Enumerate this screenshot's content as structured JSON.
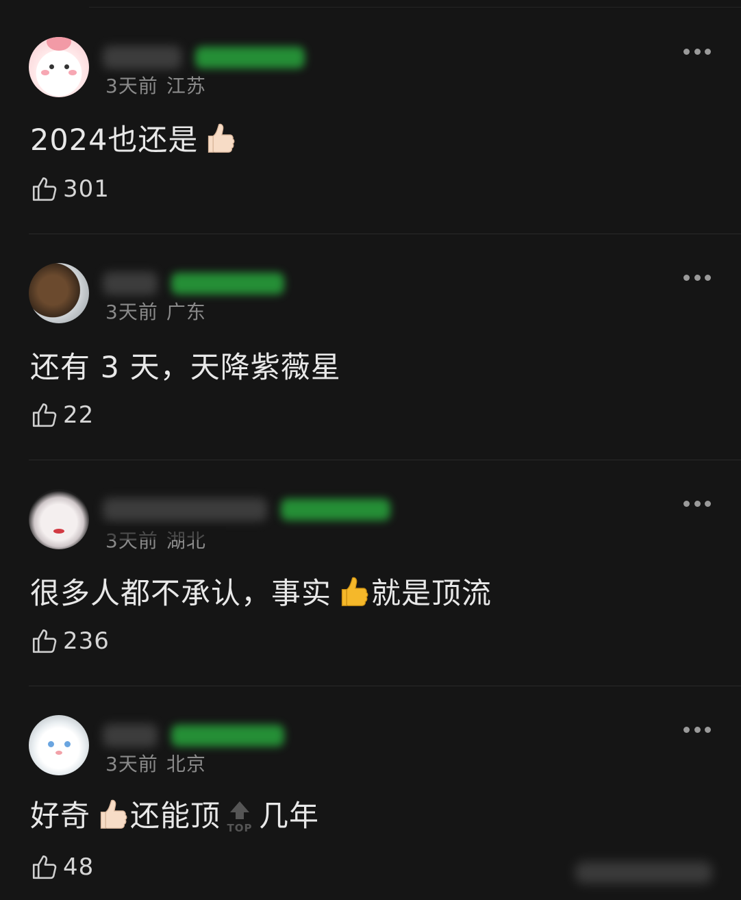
{
  "colors": {
    "background": "#151515",
    "text_primary": "#e8e8e8",
    "text_secondary": "#8a8a8a",
    "divider": "#2a2a2a",
    "tag_green": "#28a43c",
    "thumb_light": "#f7dcc6",
    "thumb_yellow": "#f5b82a"
  },
  "comments": [
    {
      "time": "3天前",
      "location": "江苏",
      "content_before": "2024也还是",
      "thumb_emoji": "thumbs-up-light",
      "content_after": "",
      "likes": "301"
    },
    {
      "time": "3天前",
      "location": "广东",
      "content_before": "还有 3 天，天降紫薇星",
      "likes": "22"
    },
    {
      "time": "3天前",
      "location": "湖北",
      "content_before": "很多人都不承认，事实",
      "thumb_emoji": "thumbs-up-yellow",
      "content_after": "就是顶流",
      "likes": "236"
    },
    {
      "time": "3天前",
      "location": "北京",
      "content_before": "好奇",
      "thumb_emoji": "thumbs-up-light",
      "content_middle": "还能顶",
      "badge_label": "TOP",
      "content_after": "几年",
      "likes": "48"
    }
  ]
}
